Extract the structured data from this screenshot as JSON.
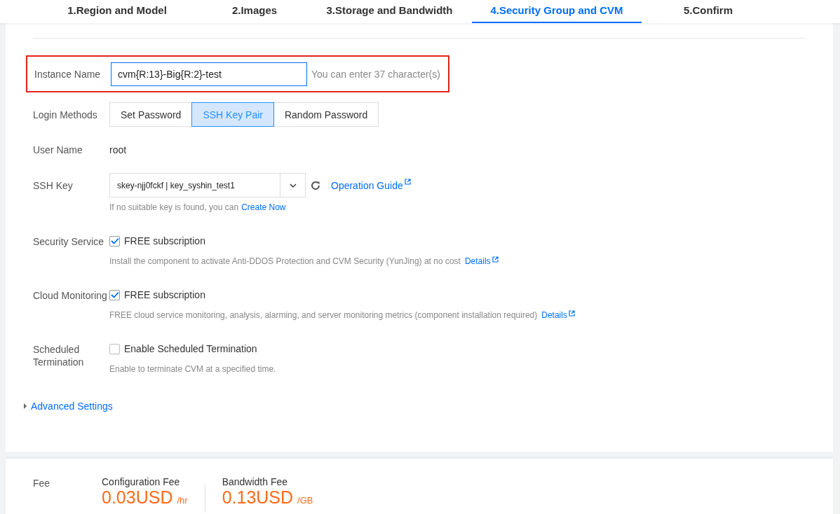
{
  "steps": [
    {
      "label": "1.Region and Model",
      "selected": false
    },
    {
      "label": "2.Images",
      "selected": false
    },
    {
      "label": "3.Storage and Bandwidth",
      "selected": false
    },
    {
      "label": "4.Security Group and CVM",
      "selected": true
    },
    {
      "label": "5.Confirm",
      "selected": false
    }
  ],
  "instance_name": {
    "label": "Instance Name",
    "value": "cvm{R:13}-Big{R:2}-test",
    "hint": "You can enter 37 character(s)",
    "highlighted": true
  },
  "login_methods": {
    "label": "Login Methods",
    "options": [
      {
        "label": "Set Password",
        "selected": false
      },
      {
        "label": "SSH Key Pair",
        "selected": true
      },
      {
        "label": "Random Password",
        "selected": false
      }
    ]
  },
  "user_name": {
    "label": "User Name",
    "value": "root"
  },
  "ssh_key": {
    "label": "SSH Key",
    "value": "skey-njj0fckf | key_syshin_test1",
    "link": "Operation Guide",
    "hint": "If no suitable key is found, you can",
    "hint_link": "Create Now"
  },
  "services": [
    {
      "label": "Security Service",
      "option": "FREE subscription",
      "checked": true,
      "description": "Install the component to activate Anti-DDOS Protection and CVM Security (YunJing) at no cost",
      "link": "Details"
    },
    {
      "label": "Cloud Monitoring",
      "option": "FREE subscription",
      "checked": true,
      "description": "FREE cloud service monitoring, analysis, alarming, and server monitoring metrics (component installation required)",
      "link": "Details"
    },
    {
      "label": "Scheduled Termination",
      "option": "Enable Scheduled Termination",
      "checked": false,
      "description": "Enable to terminate CVM at a specified time."
    }
  ],
  "advanced_settings": {
    "label": "Advanced Settings",
    "expanded": false
  },
  "fee": {
    "label": "Fee",
    "items": [
      {
        "label": "Configuration Fee",
        "amount": "0.03USD",
        "unit": "/hr"
      },
      {
        "label": "Bandwidth Fee",
        "amount": "0.13USD",
        "unit": "/GB"
      }
    ]
  }
}
